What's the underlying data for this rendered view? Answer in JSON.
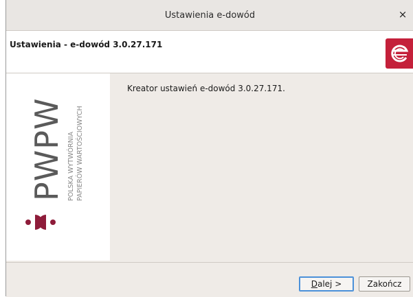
{
  "window": {
    "title": "Ustawienia e-dowód",
    "close_glyph": "×"
  },
  "header": {
    "title": "Ustawienia - e-dowód 3.0.27.171",
    "logo_icon": "e-dowod-logo-icon",
    "logo_color": "#c4203a"
  },
  "side_banner": {
    "brand": "PWPW",
    "line1": "POLSKA WYTWÓRNIA",
    "line2": "PAPIERÓW WARTOŚCIOWYCH",
    "accent_color": "#8e1c3a"
  },
  "content": {
    "text": "Kreator ustawień e-dowód 3.0.27.171."
  },
  "footer": {
    "next_mnemonic": "D",
    "next_rest": "alej >",
    "finish_label": "Zakończ"
  }
}
